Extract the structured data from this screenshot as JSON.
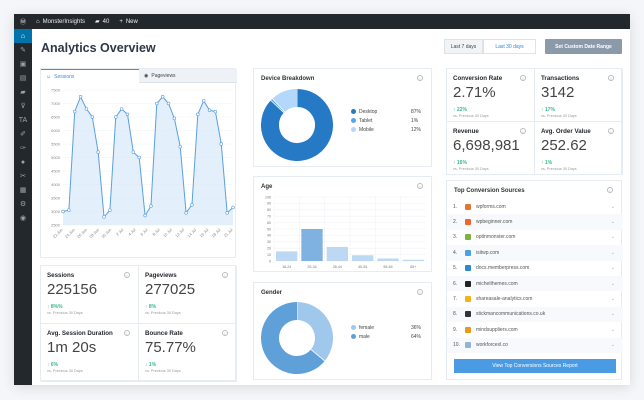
{
  "adminbar": {
    "site": "MonsterInsights",
    "comments": "40",
    "new": "New"
  },
  "page_title": "Analytics Overview",
  "date_buttons": {
    "last7": "Last 7 days",
    "last30": "Last 30 days",
    "custom": "Set Custom Date Range"
  },
  "tabs": {
    "sessions": "Sessions",
    "pageviews": "Pageviews"
  },
  "sessions_chart": {
    "type": "line",
    "x_labels": [
      "22 Jun",
      "24 Jun",
      "26 Jun",
      "28 Jun",
      "30 Jun",
      "2 Jul",
      "4 Jul",
      "6 Jul",
      "8 Jul",
      "10 Jul",
      "12 Jul",
      "14 Jul",
      "16 Jul",
      "18 Jul",
      "21 Jul"
    ],
    "values": [
      3000,
      3050,
      6700,
      7250,
      6800,
      6500,
      5200,
      2800,
      3050,
      6500,
      6800,
      6600,
      5200,
      5000,
      2850,
      3200,
      7000,
      7250,
      7000,
      6450,
      5400,
      2950,
      3250,
      6600,
      7100,
      6750,
      6700,
      5500,
      2950,
      3150
    ],
    "y_ticks": [
      7500,
      7000,
      6500,
      6000,
      5500,
      5000,
      4500,
      4000,
      3500,
      3000,
      2500
    ],
    "ylim": [
      2500,
      7500
    ],
    "color": "#5a9fe0"
  },
  "stats": [
    {
      "label": "Sessions",
      "value": "225156",
      "change": "8%%",
      "direction": "up",
      "compare": "vs. Previous 30 Days"
    },
    {
      "label": "Pageviews",
      "value": "277025",
      "change": "8%",
      "direction": "up",
      "compare": "vs. Previous 30 Days"
    },
    {
      "label": "Avg. Session Duration",
      "value": "1m 20s",
      "change": "6%",
      "direction": "up",
      "compare": "vs. Previous 30 Days"
    },
    {
      "label": "Bounce Rate",
      "value": "75.77%",
      "change": "1%",
      "direction": "down",
      "compare": "vs. Previous 30 Days"
    }
  ],
  "device": {
    "title": "Device Breakdown",
    "items": [
      {
        "label": "Desktop",
        "value": "87%",
        "pct": 87,
        "color": "#2679c5"
      },
      {
        "label": "Tablet",
        "value": "1%",
        "pct": 1,
        "color": "#5aa4e6"
      },
      {
        "label": "Mobile",
        "value": "12%",
        "pct": 12,
        "color": "#b3d8fb"
      }
    ]
  },
  "age": {
    "title": "Age",
    "categories": [
      "18-24",
      "25-34",
      "35-44",
      "45-54",
      "55-64",
      "65+"
    ],
    "values": [
      15,
      50,
      22,
      9,
      4,
      2
    ],
    "y_ticks": [
      100,
      90,
      80,
      70,
      60,
      50,
      40,
      30,
      20,
      10,
      0
    ],
    "ylim": [
      0,
      100
    ]
  },
  "gender": {
    "title": "Gender",
    "items": [
      {
        "label": "female",
        "value": "36%",
        "pct": 36,
        "color": "#9fc8ec"
      },
      {
        "label": "male",
        "value": "64%",
        "pct": 64,
        "color": "#5fa0d9"
      }
    ]
  },
  "conversions": [
    {
      "label": "Conversion Rate",
      "value": "2.71%",
      "change": "22%",
      "compare": "vs. Previous 30 Days"
    },
    {
      "label": "Transactions",
      "value": "3142",
      "change": "17%",
      "compare": "vs. Previous 30 Days"
    },
    {
      "label": "Revenue",
      "value": "6,698,981",
      "change": "16%",
      "compare": "vs. Previous 30 Days"
    },
    {
      "label": "Avg. Order Value",
      "value": "252.62",
      "change": "1%",
      "compare": "vs. Previous 30 Days"
    }
  ],
  "sources": {
    "title": "Top Conversion Sources",
    "button": "View Top Conversions Sources Report",
    "items": [
      {
        "n": "1.",
        "name": "wpforms.com",
        "color": "#e27730"
      },
      {
        "n": "2.",
        "name": "wpbeginner.com",
        "color": "#f0642e"
      },
      {
        "n": "3.",
        "name": "optinmonster.com",
        "color": "#7cb342"
      },
      {
        "n": "4.",
        "name": "isitwp.com",
        "color": "#4aa3df"
      },
      {
        "n": "5.",
        "name": "docs.memberpress.com",
        "color": "#2b8bd0"
      },
      {
        "n": "6.",
        "name": "michelthemes.com",
        "color": "#222222"
      },
      {
        "n": "7.",
        "name": "shareasale-analytics.com",
        "color": "#f6b21b"
      },
      {
        "n": "8.",
        "name": "stickmancommunications.co.uk",
        "color": "#333333"
      },
      {
        "n": "9.",
        "name": "mindsuppliers.com",
        "color": "#e89a1c"
      },
      {
        "n": "10.",
        "name": "workforcexl.co",
        "color": "#8fb3d9"
      }
    ]
  }
}
